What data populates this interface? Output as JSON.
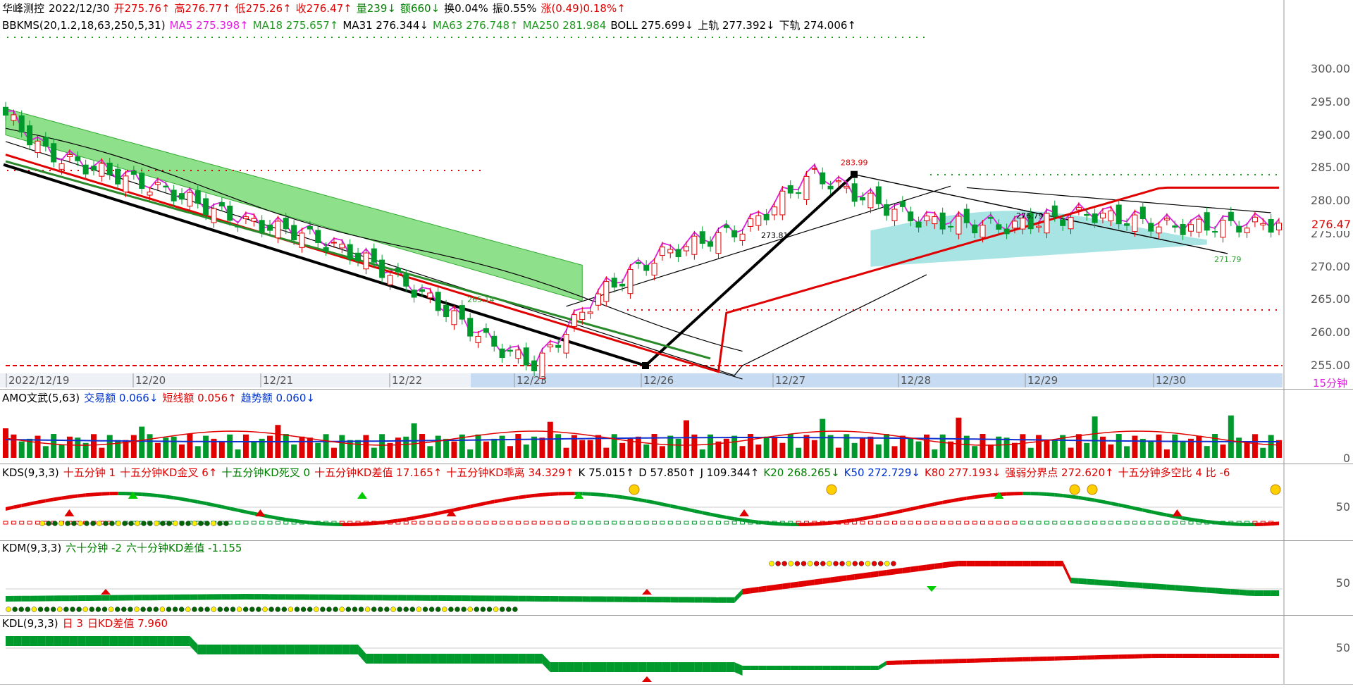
{
  "header": {
    "name": "华峰测控",
    "date": "2022/12/30",
    "open": "开275.76↑",
    "high": "高276.77↑",
    "low": "低275.26↑",
    "close": "收276.47↑",
    "volume": "量239↓",
    "amount": "额660↓",
    "turnover": "换0.04%",
    "amplitude": "振0.55%",
    "change": "涨(0.49)0.18%↑"
  },
  "indicator_line": {
    "name": "BBKMS(20,1.2,18,63,250,5,31)",
    "ma5": "MA5 275.398↑",
    "ma18": "MA18 275.657↑",
    "ma31": "MA31 276.344↓",
    "ma63": "MA63 276.748↑",
    "ma250": "MA250 281.984",
    "boll": "BOLL 275.699↓",
    "upper": "上轨 277.392↓",
    "lower": "下轨 274.006↑"
  },
  "price_axis": [
    "300.00",
    "295.00",
    "290.00",
    "285.00",
    "280.00",
    "275.00",
    "270.00",
    "265.00",
    "260.00",
    "255.00"
  ],
  "current_price": "276.47",
  "peak_labels": {
    "high": "283.99",
    "mid1": "273.81",
    "mid2": "276.79",
    "low1": "265.14",
    "low2": "271.79"
  },
  "date_axis": [
    "2022/12/19",
    "12/20",
    "12/21",
    "12/22",
    "12/23",
    "12/26",
    "12/27",
    "12/28",
    "12/29",
    "12/30"
  ],
  "timeframe": "15分钟",
  "amo": {
    "name": "AMO文武(5,63)",
    "a": "交易额 0.066↓",
    "b": "短线额 0.056↑",
    "c": "趋势额 0.060↓",
    "zero": "0"
  },
  "kds": {
    "name": "KDS(9,3,3)",
    "f1": "十五分钟 1",
    "f2": "十五分钟KD金叉 6↑",
    "f3": "十五分钟KD死叉 0",
    "f4": "十五分钟KD差值 17.165↑",
    "f5": "十五分钟KD乖离 34.329↑",
    "k": "K 75.015↑",
    "d": "D 57.850↑",
    "j": "J 109.344↑",
    "k20": "K20 268.265↓",
    "k50": "K50 272.729↓",
    "k80": "K80 277.193↓",
    "f6": "强弱分界点 272.620↑",
    "f7": "十五分钟多空比 4  比 -6",
    "level": "50"
  },
  "kdm": {
    "name": "KDM(9,3,3)",
    "f1": "六十分钟 -2",
    "f2": "六十分钟KD差值 -1.155",
    "level": "50"
  },
  "kdl": {
    "name": "KDL(9,3,3)",
    "f1": "日 3",
    "f2": "日KD差值 7.960",
    "level": "50"
  },
  "colors": {
    "up": "#e00000",
    "down": "#009a2c",
    "ma5": "#e020e0",
    "band": "#8fe08a",
    "cloud": "#a8e4e4",
    "amo_line": "#1030d0"
  },
  "chart_data": {
    "type": "candlestick",
    "title": "华峰测控 15分钟",
    "categories": [
      "12/19",
      "12/20",
      "12/21",
      "12/22",
      "12/23",
      "12/26",
      "12/27",
      "12/28",
      "12/29",
      "12/30"
    ],
    "series": [
      {
        "name": "close",
        "values": [
          286.0,
          283.5,
          279.5,
          274.5,
          262.0,
          270.0,
          278.5,
          277.5,
          277.0,
          276.47
        ]
      },
      {
        "name": "MA5",
        "values": [
          285.5,
          283.0,
          279.0,
          275.0,
          262.5,
          268.0,
          282.0,
          276.5,
          278.5,
          275.398
        ]
      },
      {
        "name": "MA250",
        "values": [
          292.0,
          289.0,
          285.0,
          280.0,
          274.0,
          269.0,
          269.5,
          272.5,
          276.0,
          281.984
        ]
      }
    ],
    "extremes": {
      "high": 283.99,
      "low": 255.0
    },
    "ylim": [
      254,
      302
    ]
  }
}
